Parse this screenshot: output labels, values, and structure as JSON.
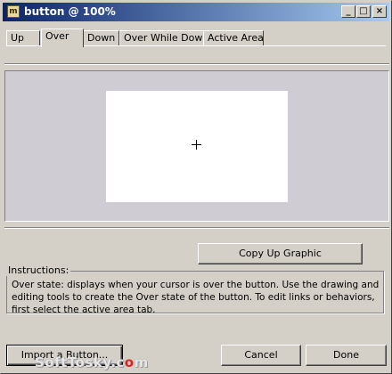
{
  "window": {
    "title": "button @ 100%",
    "minimize_glyph": "_",
    "maximize_glyph": "□",
    "close_glyph": "×",
    "app_icon_glyph": "m"
  },
  "tabs": [
    {
      "label": "Up",
      "active": false
    },
    {
      "label": "Over",
      "active": true
    },
    {
      "label": "Down",
      "active": false
    },
    {
      "label": "Over While Down",
      "active": false
    },
    {
      "label": "Active Area",
      "active": false
    }
  ],
  "canvas": {
    "crosshair": "crosshair-icon"
  },
  "actions": {
    "copy_up_graphic": "Copy Up Graphic",
    "import_button": "Import a Button...",
    "cancel": "Cancel",
    "done": "Done"
  },
  "instructions": {
    "heading": "Instructions:",
    "text": "Over state: displays when your cursor is over the button. Use the drawing and editing tools to create the Over state of the button. To edit links or behaviors, first select the active area tab."
  },
  "watermark": {
    "prefix": "Soft",
    "mid": "Tosky",
    "c": "c",
    "o": "o",
    "m": "m"
  },
  "colors": {
    "titlebar_start": "#0a246a",
    "titlebar_end": "#a6caf0",
    "face": "#d4d0c8",
    "canvas_bg": "#cfccd3",
    "stage": "#ffffff"
  }
}
